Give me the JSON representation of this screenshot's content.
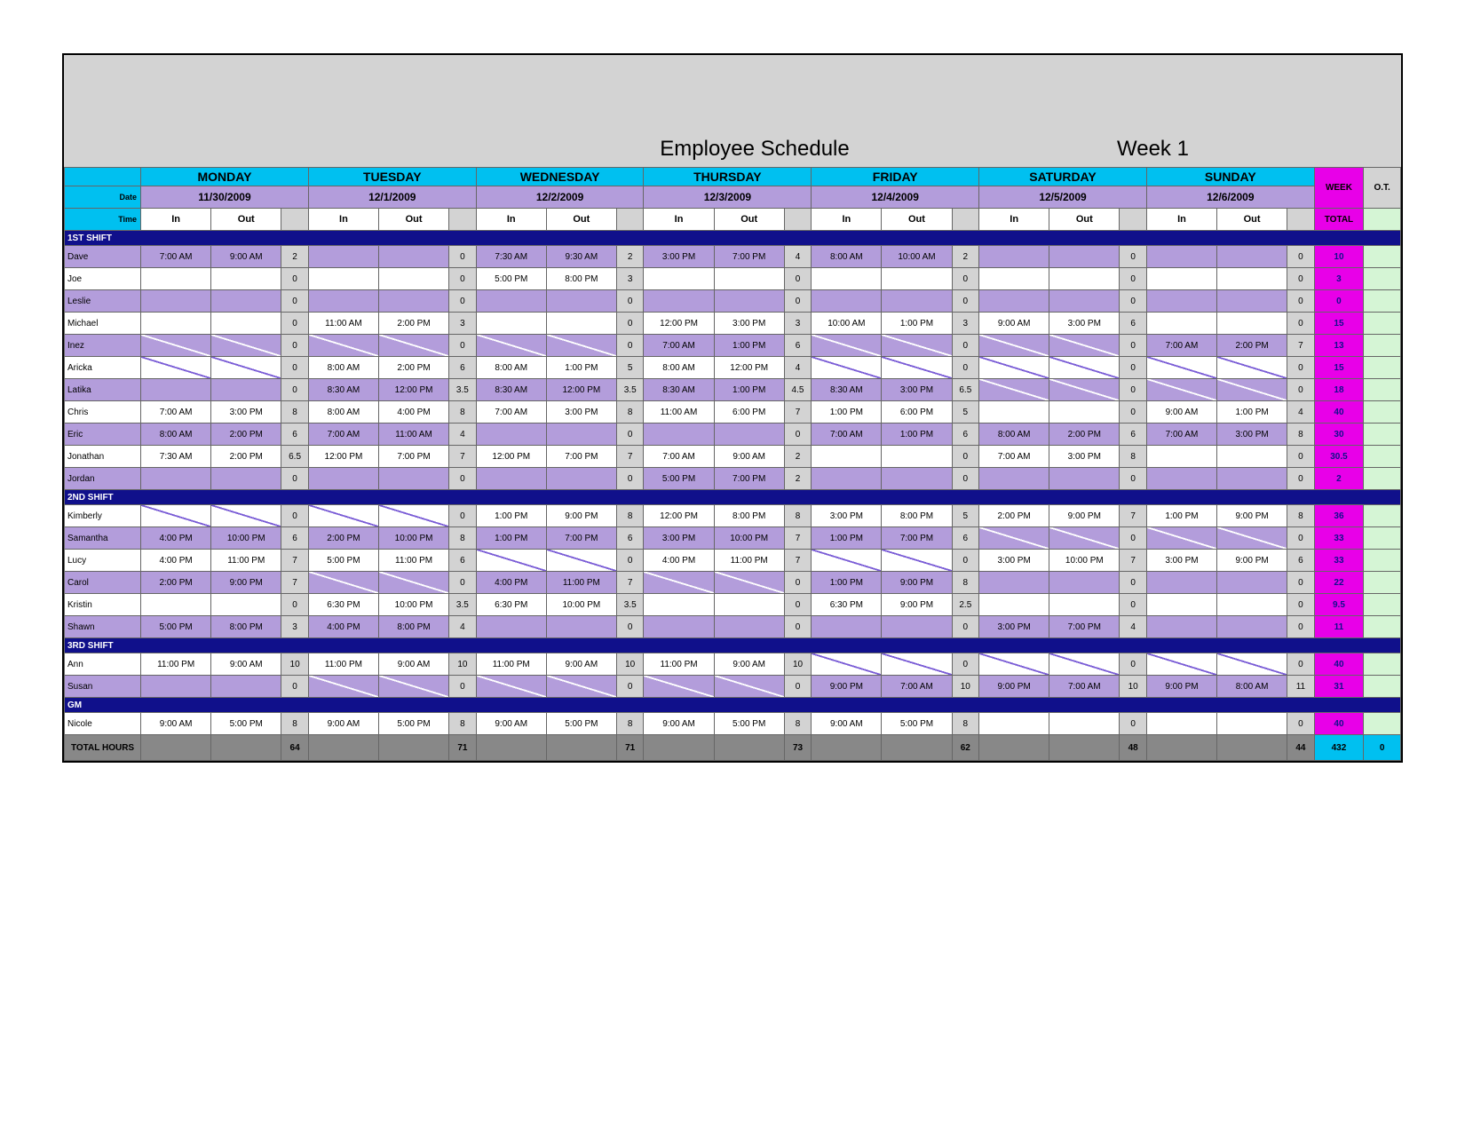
{
  "title": "Employee Schedule",
  "week_label": "Week 1",
  "row_labels": {
    "date": "Date",
    "time": "Time",
    "in": "In",
    "out": "Out"
  },
  "days": [
    {
      "name": "MONDAY",
      "date": "11/30/2009"
    },
    {
      "name": "TUESDAY",
      "date": "12/1/2009"
    },
    {
      "name": "WEDNESDAY",
      "date": "12/2/2009"
    },
    {
      "name": "THURSDAY",
      "date": "12/3/2009"
    },
    {
      "name": "FRIDAY",
      "date": "12/4/2009"
    },
    {
      "name": "SATURDAY",
      "date": "12/5/2009"
    },
    {
      "name": "SUNDAY",
      "date": "12/6/2009"
    }
  ],
  "week_col": "WEEK",
  "ot_col": "O.T.",
  "total_col": "TOTAL",
  "shifts": [
    {
      "label": "1ST SHIFT",
      "rows": [
        {
          "name": "Dave",
          "alt": true,
          "d": [
            [
              "7:00 AM",
              "9:00 AM",
              "2"
            ],
            [
              "",
              "",
              "0"
            ],
            [
              "7:30 AM",
              "9:30 AM",
              "2"
            ],
            [
              "3:00 PM",
              "7:00 PM",
              "4"
            ],
            [
              "8:00 AM",
              "10:00 AM",
              "2"
            ],
            [
              "",
              "",
              "0"
            ],
            [
              "",
              "",
              "0"
            ]
          ],
          "wk": "10",
          "ot": ""
        },
        {
          "name": "Joe",
          "alt": false,
          "d": [
            [
              "",
              "",
              "0"
            ],
            [
              "",
              "",
              "0"
            ],
            [
              "5:00 PM",
              "8:00 PM",
              "3"
            ],
            [
              "",
              "",
              "0"
            ],
            [
              "",
              "",
              "0"
            ],
            [
              "",
              "",
              "0"
            ],
            [
              "",
              "",
              "0"
            ]
          ],
          "wk": "3",
          "ot": ""
        },
        {
          "name": "Leslie",
          "alt": true,
          "d": [
            [
              "",
              "",
              "0"
            ],
            [
              "",
              "",
              "0"
            ],
            [
              "",
              "",
              "0"
            ],
            [
              "",
              "",
              "0"
            ],
            [
              "",
              "",
              "0"
            ],
            [
              "",
              "",
              "0"
            ],
            [
              "",
              "",
              "0"
            ]
          ],
          "wk": "0",
          "ot": ""
        },
        {
          "name": "Michael",
          "alt": false,
          "d": [
            [
              "",
              "",
              "0"
            ],
            [
              "11:00 AM",
              "2:00 PM",
              "3"
            ],
            [
              "",
              "",
              "0"
            ],
            [
              "12:00 PM",
              "3:00 PM",
              "3"
            ],
            [
              "10:00 AM",
              "1:00 PM",
              "3"
            ],
            [
              "9:00 AM",
              "3:00 PM",
              "6"
            ],
            [
              "",
              "",
              "0"
            ]
          ],
          "wk": "15",
          "ot": ""
        },
        {
          "name": "Inez",
          "alt": true,
          "d": [
            [
              "/",
              "/",
              "0"
            ],
            [
              "/",
              "/",
              "0"
            ],
            [
              "/",
              "/",
              "0"
            ],
            [
              "7:00 AM",
              "1:00 PM",
              "6"
            ],
            [
              "/",
              "/",
              "0"
            ],
            [
              "/",
              "/",
              "0"
            ],
            [
              "7:00 AM",
              "2:00 PM",
              "7"
            ]
          ],
          "wk": "13",
          "ot": ""
        },
        {
          "name": "Aricka",
          "alt": false,
          "d": [
            [
              "/",
              "/",
              "0"
            ],
            [
              "8:00 AM",
              "2:00 PM",
              "6"
            ],
            [
              "8:00 AM",
              "1:00 PM",
              "5"
            ],
            [
              "8:00 AM",
              "12:00 PM",
              "4"
            ],
            [
              "/",
              "/",
              "0"
            ],
            [
              "/",
              "/",
              "0"
            ],
            [
              "/",
              "/",
              "0"
            ]
          ],
          "wk": "15",
          "ot": ""
        },
        {
          "name": "Latika",
          "alt": true,
          "d": [
            [
              "",
              "",
              "0"
            ],
            [
              "8:30 AM",
              "12:00 PM",
              "3.5"
            ],
            [
              "8:30 AM",
              "12:00 PM",
              "3.5"
            ],
            [
              "8:30 AM",
              "1:00 PM",
              "4.5"
            ],
            [
              "8:30 AM",
              "3:00 PM",
              "6.5"
            ],
            [
              "/",
              "/",
              "0"
            ],
            [
              "/",
              "/",
              "0"
            ]
          ],
          "wk": "18",
          "ot": ""
        },
        {
          "name": "Chris",
          "alt": false,
          "d": [
            [
              "7:00 AM",
              "3:00 PM",
              "8"
            ],
            [
              "8:00 AM",
              "4:00 PM",
              "8"
            ],
            [
              "7:00 AM",
              "3:00 PM",
              "8"
            ],
            [
              "11:00 AM",
              "6:00 PM",
              "7"
            ],
            [
              "1:00 PM",
              "6:00 PM",
              "5"
            ],
            [
              "",
              "",
              "0"
            ],
            [
              "9:00 AM",
              "1:00 PM",
              "4"
            ]
          ],
          "wk": "40",
          "ot": ""
        },
        {
          "name": "Eric",
          "alt": true,
          "d": [
            [
              "8:00 AM",
              "2:00 PM",
              "6"
            ],
            [
              "7:00 AM",
              "11:00 AM",
              "4"
            ],
            [
              "",
              "",
              "0"
            ],
            [
              "",
              "",
              "0"
            ],
            [
              "7:00 AM",
              "1:00 PM",
              "6"
            ],
            [
              "8:00 AM",
              "2:00 PM",
              "6"
            ],
            [
              "7:00 AM",
              "3:00 PM",
              "8"
            ]
          ],
          "wk": "30",
          "ot": ""
        },
        {
          "name": "Jonathan",
          "alt": false,
          "d": [
            [
              "7:30 AM",
              "2:00 PM",
              "6.5"
            ],
            [
              "12:00 PM",
              "7:00 PM",
              "7"
            ],
            [
              "12:00 PM",
              "7:00 PM",
              "7"
            ],
            [
              "7:00 AM",
              "9:00 AM",
              "2"
            ],
            [
              "",
              "",
              "0"
            ],
            [
              "7:00 AM",
              "3:00 PM",
              "8"
            ],
            [
              "",
              "",
              "0"
            ]
          ],
          "wk": "30.5",
          "ot": ""
        },
        {
          "name": "Jordan",
          "alt": true,
          "d": [
            [
              "",
              "",
              "0"
            ],
            [
              "",
              "",
              "0"
            ],
            [
              "",
              "",
              "0"
            ],
            [
              "5:00 PM",
              "7:00 PM",
              "2"
            ],
            [
              "",
              "",
              "0"
            ],
            [
              "",
              "",
              "0"
            ],
            [
              "",
              "",
              "0"
            ]
          ],
          "wk": "2",
          "ot": ""
        }
      ]
    },
    {
      "label": "2ND SHIFT",
      "rows": [
        {
          "name": "Kimberly",
          "alt": false,
          "d": [
            [
              "/",
              "/",
              "0"
            ],
            [
              "/",
              "/",
              "0"
            ],
            [
              "1:00 PM",
              "9:00 PM",
              "8"
            ],
            [
              "12:00 PM",
              "8:00 PM",
              "8"
            ],
            [
              "3:00 PM",
              "8:00 PM",
              "5"
            ],
            [
              "2:00 PM",
              "9:00 PM",
              "7"
            ],
            [
              "1:00 PM",
              "9:00 PM",
              "8"
            ]
          ],
          "wk": "36",
          "ot": ""
        },
        {
          "name": "Samantha",
          "alt": true,
          "d": [
            [
              "4:00 PM",
              "10:00 PM",
              "6"
            ],
            [
              "2:00 PM",
              "10:00 PM",
              "8"
            ],
            [
              "1:00 PM",
              "7:00 PM",
              "6"
            ],
            [
              "3:00 PM",
              "10:00 PM",
              "7"
            ],
            [
              "1:00 PM",
              "7:00 PM",
              "6"
            ],
            [
              "/",
              "/",
              "0"
            ],
            [
              "/",
              "/",
              "0"
            ]
          ],
          "wk": "33",
          "ot": ""
        },
        {
          "name": "Lucy",
          "alt": false,
          "d": [
            [
              "4:00 PM",
              "11:00 PM",
              "7"
            ],
            [
              "5:00 PM",
              "11:00 PM",
              "6"
            ],
            [
              "/",
              "/",
              "0"
            ],
            [
              "4:00 PM",
              "11:00 PM",
              "7"
            ],
            [
              "/",
              "/",
              "0"
            ],
            [
              "3:00 PM",
              "10:00 PM",
              "7"
            ],
            [
              "3:00 PM",
              "9:00 PM",
              "6"
            ]
          ],
          "wk": "33",
          "ot": ""
        },
        {
          "name": "Carol",
          "alt": true,
          "d": [
            [
              "2:00 PM",
              "9:00 PM",
              "7"
            ],
            [
              "/",
              "/",
              "0"
            ],
            [
              "4:00 PM",
              "11:00 PM",
              "7"
            ],
            [
              "/",
              "/",
              "0"
            ],
            [
              "1:00 PM",
              "9:00 PM",
              "8"
            ],
            [
              "",
              "",
              "0"
            ],
            [
              "",
              "",
              "0"
            ]
          ],
          "wk": "22",
          "ot": ""
        },
        {
          "name": "Kristin",
          "alt": false,
          "d": [
            [
              "",
              "",
              "0"
            ],
            [
              "6:30 PM",
              "10:00 PM",
              "3.5"
            ],
            [
              "6:30 PM",
              "10:00 PM",
              "3.5"
            ],
            [
              "",
              "",
              "0"
            ],
            [
              "6:30 PM",
              "9:00 PM",
              "2.5"
            ],
            [
              "",
              "",
              "0"
            ],
            [
              "",
              "",
              "0"
            ]
          ],
          "wk": "9.5",
          "ot": ""
        },
        {
          "name": "Shawn",
          "alt": true,
          "d": [
            [
              "5:00 PM",
              "8:00 PM",
              "3"
            ],
            [
              "4:00 PM",
              "8:00 PM",
              "4"
            ],
            [
              "",
              "",
              "0"
            ],
            [
              "",
              "",
              "0"
            ],
            [
              "",
              "",
              "0"
            ],
            [
              "3:00 PM",
              "7:00 PM",
              "4"
            ],
            [
              "",
              "",
              "0"
            ]
          ],
          "wk": "11",
          "ot": ""
        }
      ]
    },
    {
      "label": "3RD SHIFT",
      "rows": [
        {
          "name": "Ann",
          "alt": false,
          "d": [
            [
              "11:00 PM",
              "9:00 AM",
              "10"
            ],
            [
              "11:00 PM",
              "9:00 AM",
              "10"
            ],
            [
              "11:00 PM",
              "9:00 AM",
              "10"
            ],
            [
              "11:00 PM",
              "9:00 AM",
              "10"
            ],
            [
              "/",
              "/",
              "0"
            ],
            [
              "/",
              "/",
              "0"
            ],
            [
              "/",
              "/",
              "0"
            ]
          ],
          "wk": "40",
          "ot": ""
        },
        {
          "name": "Susan",
          "alt": true,
          "d": [
            [
              "",
              "",
              "0"
            ],
            [
              "/",
              "/",
              "0"
            ],
            [
              "/",
              "/",
              "0"
            ],
            [
              "/",
              "/",
              "0"
            ],
            [
              "9:00 PM",
              "7:00 AM",
              "10"
            ],
            [
              "9:00 PM",
              "7:00 AM",
              "10"
            ],
            [
              "9:00 PM",
              "8:00 AM",
              "11"
            ]
          ],
          "wk": "31",
          "ot": ""
        }
      ]
    },
    {
      "label": "GM",
      "rows": [
        {
          "name": "Nicole",
          "alt": false,
          "d": [
            [
              "9:00 AM",
              "5:00 PM",
              "8"
            ],
            [
              "9:00 AM",
              "5:00 PM",
              "8"
            ],
            [
              "9:00 AM",
              "5:00 PM",
              "8"
            ],
            [
              "9:00 AM",
              "5:00 PM",
              "8"
            ],
            [
              "9:00 AM",
              "5:00 PM",
              "8"
            ],
            [
              "",
              "",
              "0"
            ],
            [
              "",
              "",
              "0"
            ]
          ],
          "wk": "40",
          "ot": ""
        }
      ]
    }
  ],
  "totals": {
    "label": "TOTAL HOURS",
    "days": [
      "64",
      "71",
      "71",
      "73",
      "62",
      "48",
      "44"
    ],
    "week": "432",
    "ot": "0"
  }
}
